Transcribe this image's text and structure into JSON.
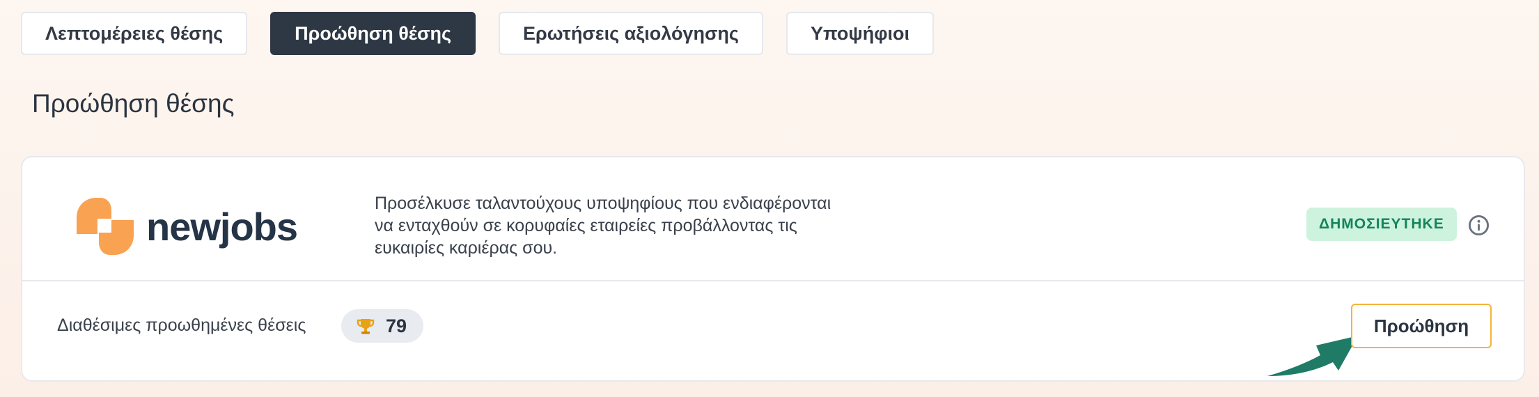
{
  "tabs": [
    {
      "label": "Λεπτομέρειες θέσης",
      "active": false
    },
    {
      "label": "Προώθηση θέσης",
      "active": true
    },
    {
      "label": "Ερωτήσεις αξιολόγησης",
      "active": false
    },
    {
      "label": "Υποψήφιοι",
      "active": false
    }
  ],
  "page": {
    "title": "Προώθηση θέσης"
  },
  "card": {
    "logo_text": "newjobs",
    "description_lines": [
      "Προσέλκυσε ταλαντούχους υποψηφίους που ενδιαφέρονται",
      "να ενταχθούν σε κορυφαίες εταιρείες προβάλλοντας τις",
      "ευκαιρίες καριέρας σου."
    ],
    "status_badge": "ΔΗΜΟΣΙΕΥΤΗΚΕ",
    "available_label": "Διαθέσιμες προωθημένες θέσεις",
    "available_count": "79",
    "promote_button": "Προώθηση"
  },
  "icons": {
    "logo": "newjobs-logo-icon",
    "info": "info-icon",
    "trophy": "trophy-icon",
    "arrow": "pointer-arrow-icon"
  },
  "colors": {
    "active_tab": "#2e3744",
    "badge_bg": "#cdf3df",
    "badge_text": "#15835b",
    "logo_orange": "#f9a252",
    "button_border": "#f5b33b",
    "arrow": "#1f7a66"
  }
}
